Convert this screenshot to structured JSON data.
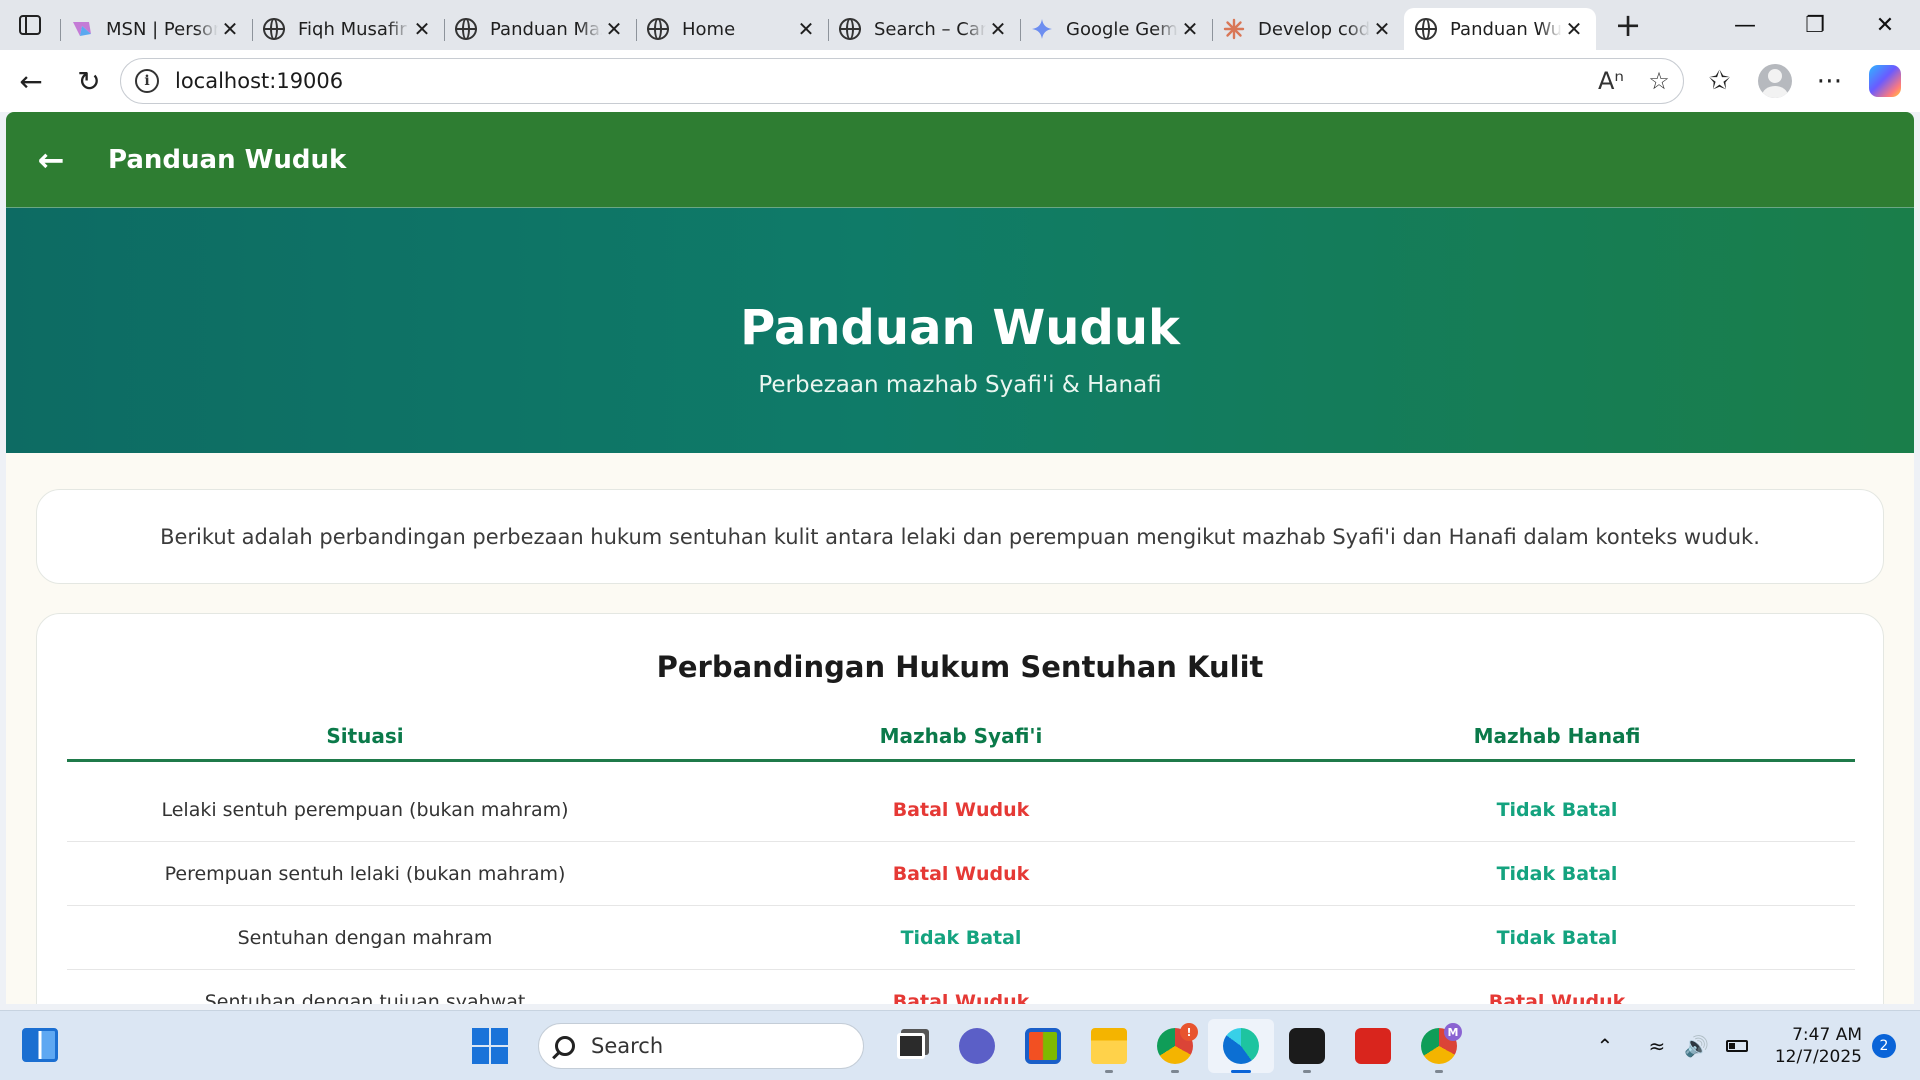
{
  "browser": {
    "tabs": [
      {
        "title": "MSN | Personalized News",
        "icon": "msn-icon",
        "active": false
      },
      {
        "title": "Fiqh Musafir",
        "icon": "globe-icon",
        "active": false
      },
      {
        "title": "Panduan Mazhab",
        "icon": "globe-icon",
        "active": false
      },
      {
        "title": "Home",
        "icon": "globe-icon",
        "active": false
      },
      {
        "title": "Search – Canva",
        "icon": "globe-icon",
        "active": false
      },
      {
        "title": "Google Gemini",
        "icon": "gemini-icon",
        "active": false
      },
      {
        "title": "Develop code",
        "icon": "claude-icon",
        "active": false
      },
      {
        "title": "Panduan Wuduk",
        "icon": "globe-icon",
        "active": true
      }
    ],
    "url": "localhost:19006"
  },
  "app": {
    "header_title": "Panduan Wuduk",
    "hero_title": "Panduan Wuduk",
    "hero_subtitle": "Perbezaan mazhab Syafi'i & Hanafi",
    "intro": "Berikut adalah perbandingan perbezaan hukum sentuhan kulit antara lelaki dan perempuan mengikut mazhab Syafi'i dan Hanafi dalam konteks wuduk.",
    "table": {
      "title": "Perbandingan Hukum Sentuhan Kulit",
      "headers": [
        "Situasi",
        "Mazhab Syafi'i",
        "Mazhab Hanafi"
      ],
      "rows": [
        {
          "situasi": "Lelaki sentuh perempuan (bukan mahram)",
          "syafii": "Batal Wuduk",
          "hanafi": "Tidak Batal"
        },
        {
          "situasi": "Perempuan sentuh lelaki (bukan mahram)",
          "syafii": "Batal Wuduk",
          "hanafi": "Tidak Batal"
        },
        {
          "situasi": "Sentuhan dengan mahram",
          "syafii": "Tidak Batal",
          "hanafi": "Tidak Batal"
        },
        {
          "situasi": "Sentuhan dengan tujuan syahwat",
          "syafii": "Batal Wuduk",
          "hanafi": "Batal Wuduk"
        }
      ]
    },
    "colors": {
      "appbar": "#2e7d32",
      "batal": "#e53935",
      "tidak_batal": "#14a37f",
      "header_text": "#0b7a4a"
    }
  },
  "taskbar": {
    "search_placeholder": "Search",
    "time": "7:47 AM",
    "date": "12/7/2025",
    "notification_count": "2",
    "chrome_badge": "!",
    "chrome_profile_badge": "M"
  }
}
